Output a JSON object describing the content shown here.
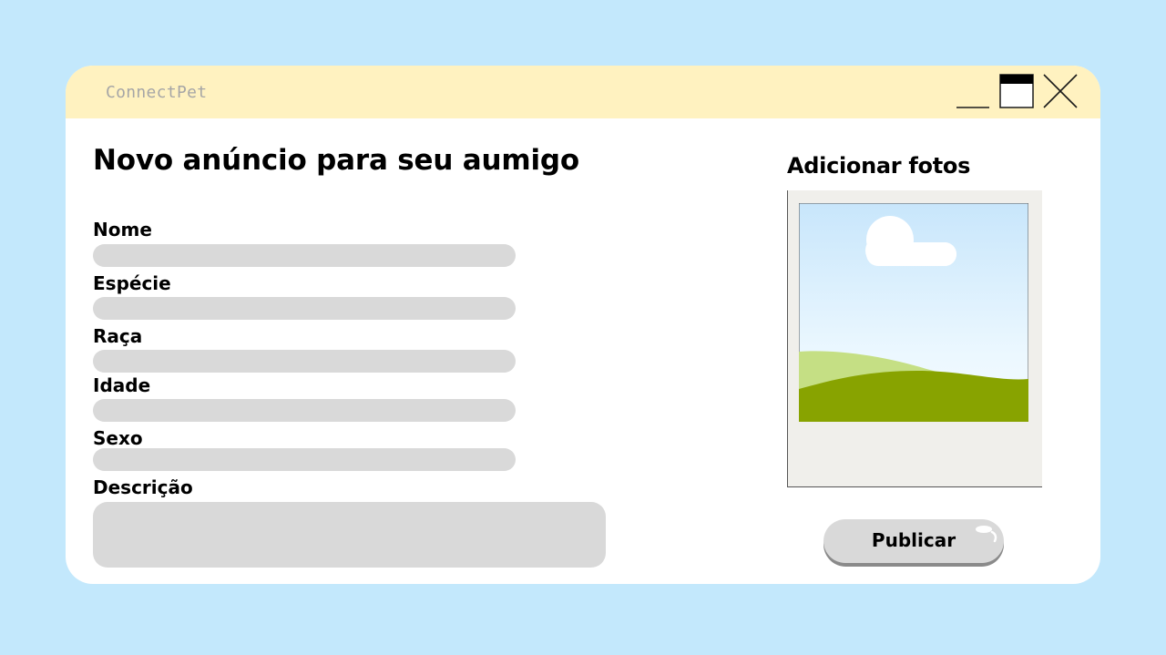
{
  "window": {
    "app_name": "ConnectPet",
    "controls": {
      "minimize_icon": "minimize-icon",
      "maximize_icon": "maximize-icon",
      "close_icon": "close-icon"
    }
  },
  "form": {
    "title": "Novo anúncio para seu aumigo",
    "fields": [
      {
        "label": "Nome",
        "value": ""
      },
      {
        "label": "Espécie",
        "value": ""
      },
      {
        "label": "Raça",
        "value": ""
      },
      {
        "label": "Idade",
        "value": ""
      },
      {
        "label": "Sexo",
        "value": ""
      }
    ],
    "description": {
      "label": "Descrição",
      "value": ""
    }
  },
  "photos": {
    "title": "Adicionar fotos",
    "placeholder_icon": "image-placeholder-icon"
  },
  "actions": {
    "publish_label": "Publicar"
  },
  "colors": {
    "background": "#c3e8fc",
    "titlebar": "#fff2c0",
    "window": "#ffffff",
    "input_fill": "#d9d9d9",
    "photo_frame": "#f0efeb",
    "hill_light": "#c5df84",
    "hill_dark": "#88a300"
  }
}
